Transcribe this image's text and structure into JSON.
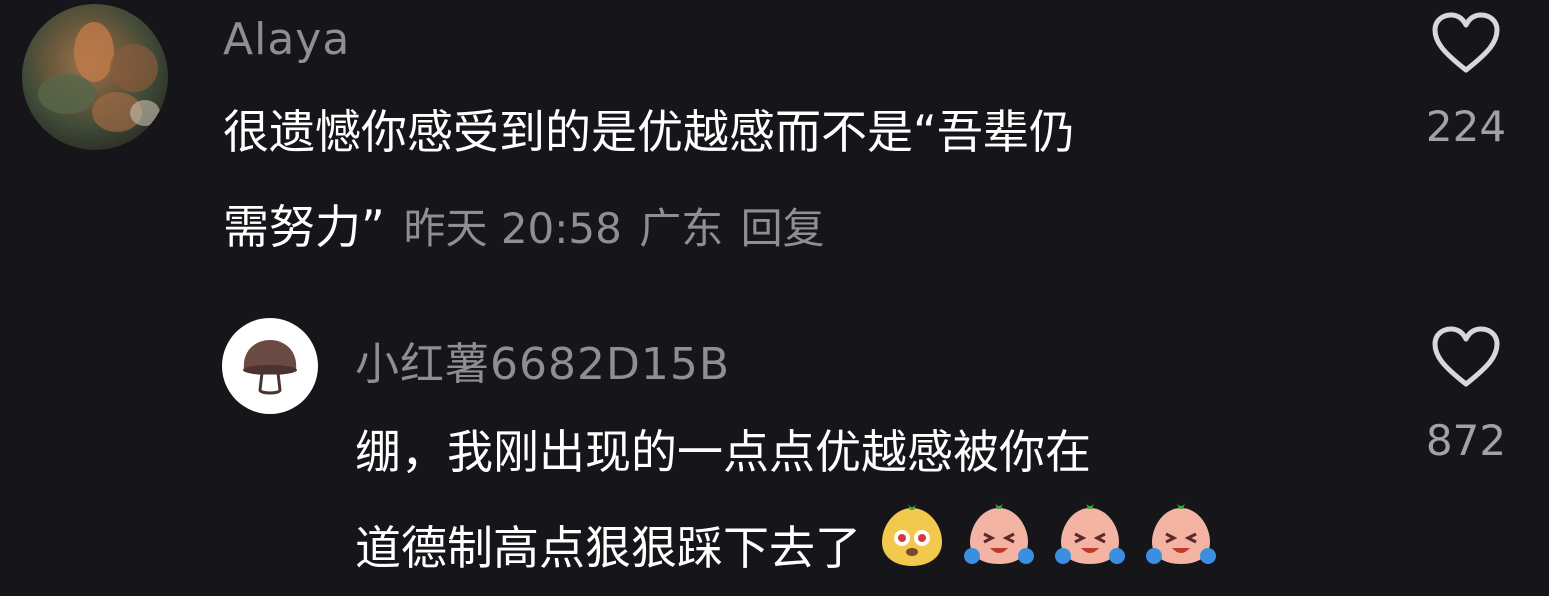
{
  "comment": {
    "user": "Alaya",
    "line1": "很遗憾你感受到的是优越感而不是“吾辈仍",
    "line2": "需努力”",
    "time": "昨天 20:58",
    "location": "广东",
    "reply_label": "回复",
    "likes": "224",
    "avatar_icon": "avatar-photo"
  },
  "reply": {
    "user": "小红薯6682D15B",
    "line1": "绷，我刚出现的一点点优越感被你在",
    "line2": "道德制高点狠狠踩下去了",
    "likes": "872",
    "avatar_icon": "mushroom-icon",
    "emojis": [
      "dog-face-sticker",
      "crying-face-sticker",
      "crying-face-sticker",
      "crying-face-sticker"
    ]
  },
  "colors": {
    "background": "#16161a",
    "secondary_text": "#8e8e93",
    "primary_text": "#ffffff"
  }
}
